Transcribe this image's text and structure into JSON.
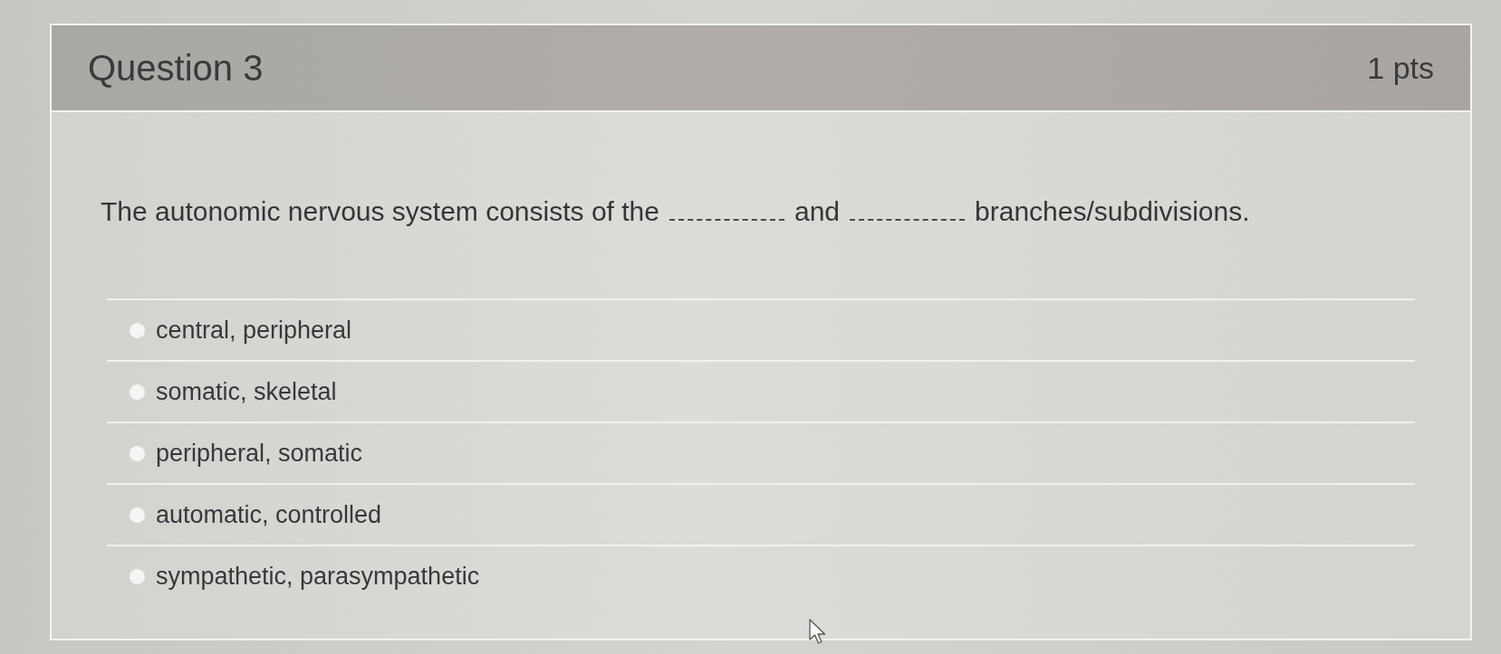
{
  "question": {
    "title": "Question 3",
    "points": "1 pts",
    "segments": [
      {
        "kind": "text",
        "text": "The autonomic nervous system consists of the"
      },
      {
        "kind": "blank"
      },
      {
        "kind": "text",
        "text": "and"
      },
      {
        "kind": "blank"
      },
      {
        "kind": "text",
        "text": "branches/subdivisions."
      }
    ]
  },
  "answers": [
    {
      "label": "central, peripheral",
      "selected": false
    },
    {
      "label": "somatic, skeletal",
      "selected": false
    },
    {
      "label": "peripheral, somatic",
      "selected": false
    },
    {
      "label": "automatic, controlled",
      "selected": false
    },
    {
      "label": "sympathetic, parasympathetic",
      "selected": false
    }
  ]
}
